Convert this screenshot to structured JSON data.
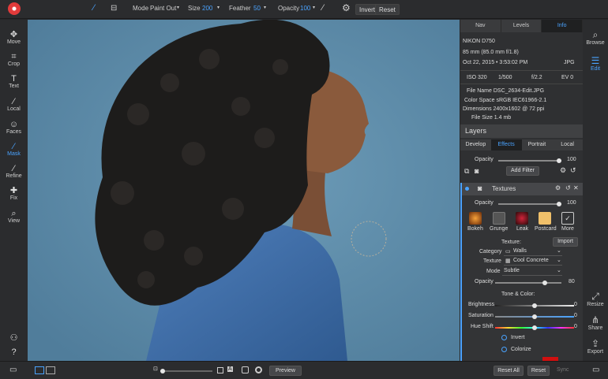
{
  "toolbar": {
    "mode_label": "Mode",
    "mode_value": "Paint Out",
    "size_label": "Size",
    "size_value": "200",
    "feather_label": "Feather",
    "feather_value": "50",
    "opacity_label": "Opacity",
    "opacity_value": "100",
    "invert": "Invert",
    "reset": "Reset"
  },
  "left_tools": [
    {
      "label": "Move",
      "icon": "move-icon"
    },
    {
      "label": "Crop",
      "icon": "crop-icon"
    },
    {
      "label": "Text",
      "icon": "text-icon"
    },
    {
      "label": "Local",
      "icon": "brush-icon"
    },
    {
      "label": "Faces",
      "icon": "faces-icon"
    },
    {
      "label": "Mask",
      "icon": "mask-icon"
    },
    {
      "label": "Refine",
      "icon": "refine-icon"
    },
    {
      "label": "Fix",
      "icon": "fix-icon"
    },
    {
      "label": "View",
      "icon": "zoom-icon"
    }
  ],
  "panel": {
    "tabs": [
      "Nav",
      "Levels",
      "Info"
    ],
    "info": {
      "camera": "NIKON D750",
      "lens": "85 mm (85.0 mm f/1.8)",
      "date": "Oct 22, 2015 • 3:53:02 PM",
      "format": "JPG",
      "iso": "ISO 320",
      "shutter": "1/500",
      "aperture": "f/2.2",
      "ev": "EV 0",
      "file_name": "File Name DSC_2634-Edit.JPG",
      "color_space": "Color Space sRGB IEC61966-2.1",
      "dimensions": "Dimensions 2400x1602 @ 72 ppi",
      "file_size": "File Size 1.4 mb"
    },
    "layers_title": "Layers",
    "layer_tabs": [
      "Develop",
      "Effects",
      "Portrait",
      "Local"
    ],
    "opacity_label": "Opacity",
    "opacity_value": "100",
    "add_filter": "Add Filter",
    "textures": {
      "title": "Textures",
      "opacity_label": "Opacity",
      "opacity_value": "100",
      "presets": [
        "Bokeh",
        "Grunge",
        "Leak",
        "Postcard",
        "More"
      ],
      "texture_label": "Texture:",
      "import": "Import",
      "category_label": "Category",
      "category_value": "Walls",
      "texture_field_label": "Texture",
      "texture_value": "Cool Concrete",
      "mode_label": "Mode",
      "mode_value": "Subtle",
      "opacity2_label": "Opacity",
      "opacity2_value": "80",
      "tone_label": "Tone & Color:",
      "brightness_label": "Brightness",
      "brightness_value": "0",
      "saturation_label": "Saturation",
      "saturation_value": "0",
      "hue_label": "Hue Shift",
      "hue_value": "0",
      "invert_label": "Invert",
      "colorize_label": "Colorize"
    }
  },
  "right_tools": [
    {
      "label": "Browse",
      "icon": "browse-icon"
    },
    {
      "label": "Edit",
      "icon": "edit-icon"
    },
    {
      "label": "Resize",
      "icon": "resize-icon"
    },
    {
      "label": "Share",
      "icon": "share-icon"
    },
    {
      "label": "Export",
      "icon": "export-icon"
    }
  ],
  "bottom": {
    "preview": "Preview",
    "reset_all": "Reset All",
    "reset": "Reset",
    "sync": "Sync"
  }
}
